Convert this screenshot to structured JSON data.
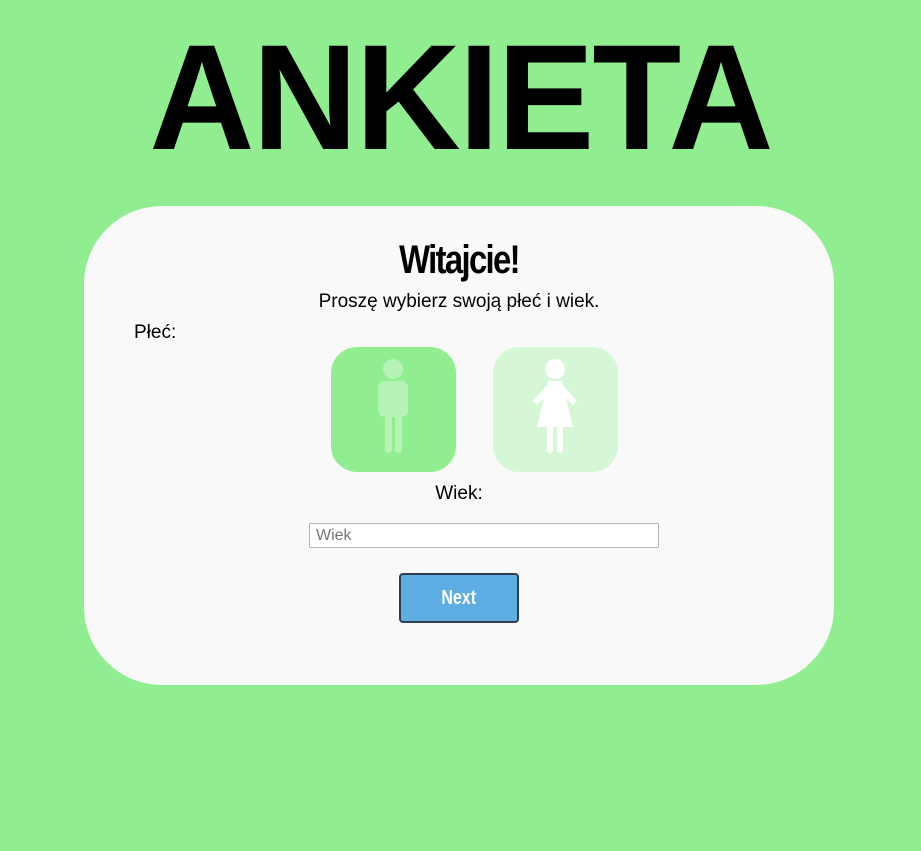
{
  "header": {
    "title": "ANKIETA"
  },
  "card": {
    "heading": "Witajcie!",
    "subtitle": "Proszę wybierz swoją płeć i wiek.",
    "gender_label": "Płeć:",
    "gender_options": [
      {
        "icon": "male-icon",
        "color": "#90ee90"
      },
      {
        "icon": "female-icon",
        "color": "#d6f7d6"
      }
    ],
    "age_label": "Wiek:",
    "age_input": {
      "value": "",
      "placeholder": "Wiek"
    },
    "next_label": "Next"
  },
  "colors": {
    "background": "#90ee90",
    "card": "#f9f9f9",
    "button": "#5dade2",
    "button_border": "#2c3e50",
    "icon_fill": "#ffffff"
  }
}
